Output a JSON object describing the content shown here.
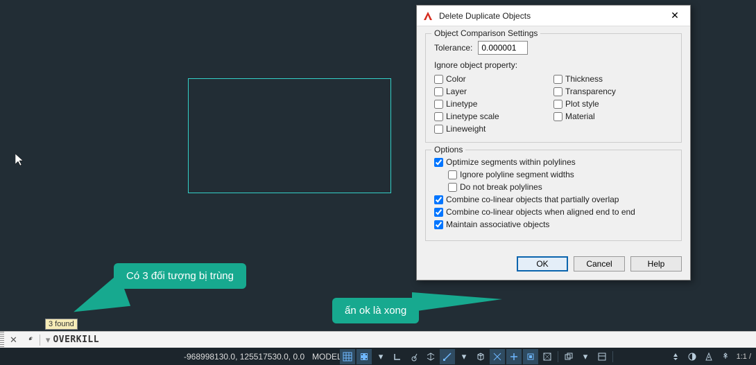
{
  "cursor_pos": "22,222",
  "selected_rect": "271,113,293,166",
  "callouts": {
    "c1": "Có 3 đối tượng bị trùng",
    "c2": "ấn ok là xong"
  },
  "tooltip": "3 found",
  "command_line": {
    "prompt": "OVERKILL"
  },
  "statusbar": {
    "coords": "-968998130.0, 125517530.0, 0.0",
    "model": "MODEL",
    "scale": "1:1 /"
  },
  "dialog": {
    "title": "Delete Duplicate Objects",
    "group1": "Object Comparison Settings",
    "tol_label": "Tolerance:",
    "tol_value": "0.000001",
    "ignore_label": "Ignore object property:",
    "props": {
      "color": "Color",
      "thickness": "Thickness",
      "layer": "Layer",
      "transparency": "Transparency",
      "linetype": "Linetype",
      "plotstyle": "Plot style",
      "ltscale": "Linetype scale",
      "material": "Material",
      "lineweight": "Lineweight"
    },
    "group2": "Options",
    "opts": {
      "optimize": "Optimize segments within polylines",
      "ignore_widths": "Ignore polyline segment widths",
      "nobreak": "Do not break polylines",
      "combine_overlap": "Combine co-linear objects that partially overlap",
      "combine_end": "Combine co-linear objects when aligned end to end",
      "maintain": "Maintain associative objects"
    },
    "buttons": {
      "ok": "OK",
      "cancel": "Cancel",
      "help": "Help"
    }
  }
}
